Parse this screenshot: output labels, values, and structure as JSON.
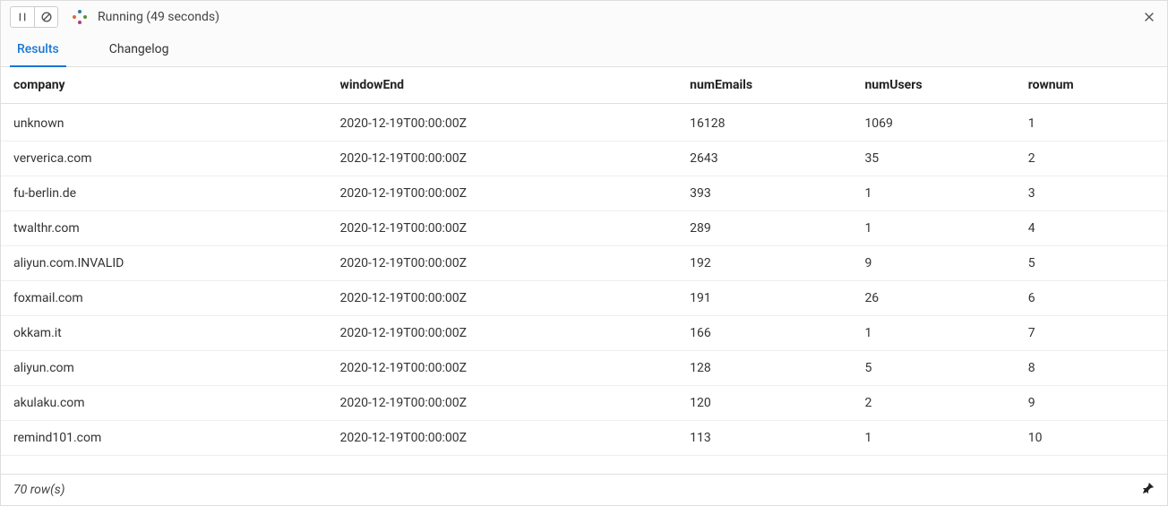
{
  "header": {
    "status": "Running (49 seconds)"
  },
  "tabs": {
    "results": "Results",
    "changelog": "Changelog"
  },
  "columns": {
    "company": "company",
    "windowEnd": "windowEnd",
    "numEmails": "numEmails",
    "numUsers": "numUsers",
    "rownum": "rownum"
  },
  "rows": [
    {
      "company": "unknown",
      "windowEnd": "2020-12-19T00:00:00Z",
      "numEmails": "16128",
      "numUsers": "1069",
      "rownum": "1"
    },
    {
      "company": "ververica.com",
      "windowEnd": "2020-12-19T00:00:00Z",
      "numEmails": "2643",
      "numUsers": "35",
      "rownum": "2"
    },
    {
      "company": "fu-berlin.de",
      "windowEnd": "2020-12-19T00:00:00Z",
      "numEmails": "393",
      "numUsers": "1",
      "rownum": "3"
    },
    {
      "company": "twalthr.com",
      "windowEnd": "2020-12-19T00:00:00Z",
      "numEmails": "289",
      "numUsers": "1",
      "rownum": "4"
    },
    {
      "company": "aliyun.com.INVALID",
      "windowEnd": "2020-12-19T00:00:00Z",
      "numEmails": "192",
      "numUsers": "9",
      "rownum": "5"
    },
    {
      "company": "foxmail.com",
      "windowEnd": "2020-12-19T00:00:00Z",
      "numEmails": "191",
      "numUsers": "26",
      "rownum": "6"
    },
    {
      "company": "okkam.it",
      "windowEnd": "2020-12-19T00:00:00Z",
      "numEmails": "166",
      "numUsers": "1",
      "rownum": "7"
    },
    {
      "company": "aliyun.com",
      "windowEnd": "2020-12-19T00:00:00Z",
      "numEmails": "128",
      "numUsers": "5",
      "rownum": "8"
    },
    {
      "company": "akulaku.com",
      "windowEnd": "2020-12-19T00:00:00Z",
      "numEmails": "120",
      "numUsers": "2",
      "rownum": "9"
    },
    {
      "company": "remind101.com",
      "windowEnd": "2020-12-19T00:00:00Z",
      "numEmails": "113",
      "numUsers": "1",
      "rownum": "10"
    }
  ],
  "footer": {
    "rowCount": "70 row(s)"
  }
}
